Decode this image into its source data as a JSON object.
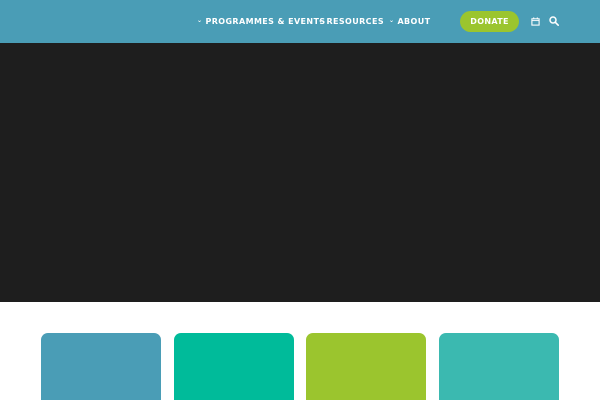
{
  "nav": {
    "items": [
      {
        "label": "PROGRAMMES & EVENTS"
      },
      {
        "label": "RESOURCES"
      },
      {
        "label": "ABOUT"
      }
    ],
    "donate_label": "DONATE",
    "icons": {
      "calendar": "calendar-icon",
      "search": "search-icon"
    }
  },
  "colors": {
    "header": "#4a9db6",
    "hero": "#1e1e1e",
    "donate": "#9bc52e",
    "cards": [
      "#4a9db6",
      "#00bb9a",
      "#9bc52e",
      "#3bb9b0"
    ]
  }
}
